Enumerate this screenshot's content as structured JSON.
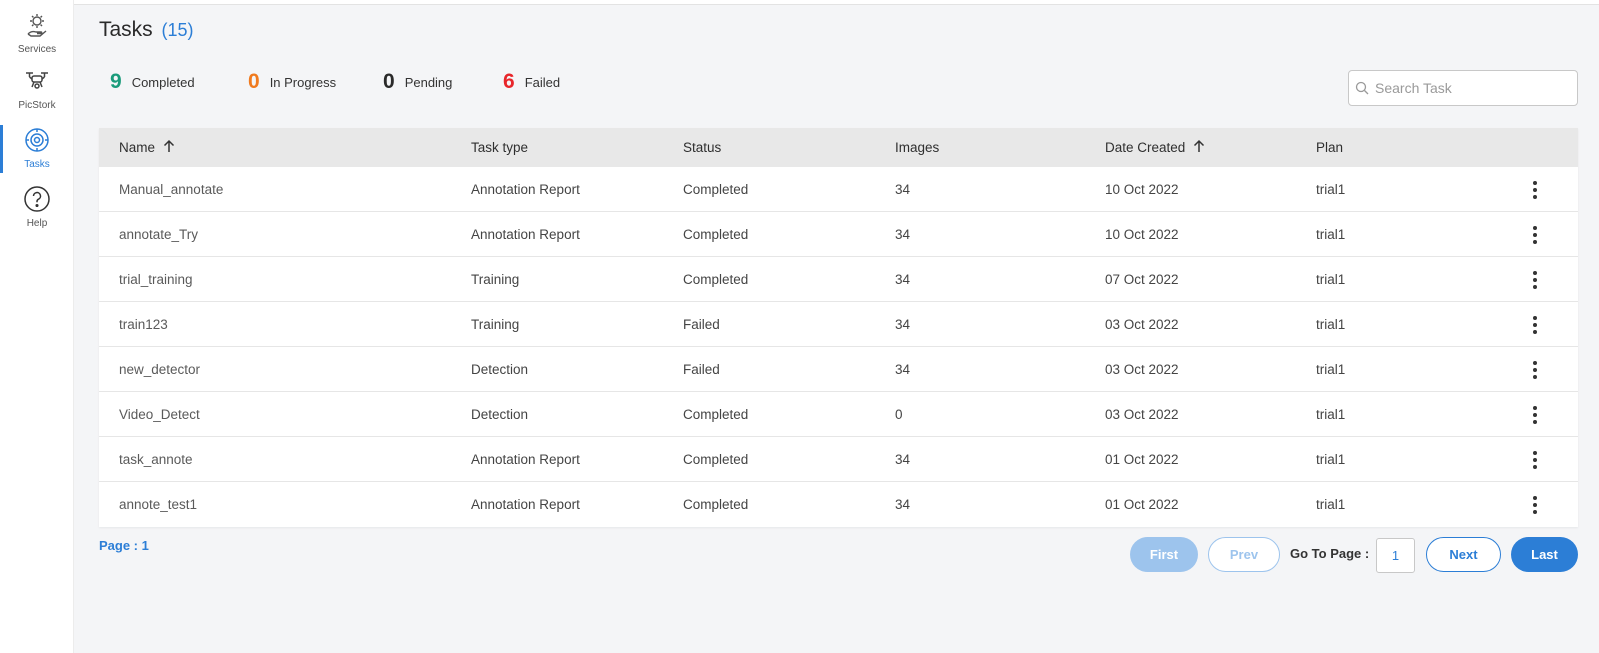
{
  "sidebar": {
    "items": [
      {
        "label": "Services",
        "icon": "gear-hand-icon"
      },
      {
        "label": "PicStork",
        "icon": "drone-icon"
      },
      {
        "label": "Tasks",
        "icon": "gears-icon",
        "active": true
      },
      {
        "label": "Help",
        "icon": "question-circle-icon"
      }
    ]
  },
  "header": {
    "title": "Tasks",
    "count": "(15)"
  },
  "summary": {
    "completed": {
      "value": "9",
      "label": "Completed",
      "color": "#1a9b7b"
    },
    "in_progress": {
      "value": "0",
      "label": "In Progress",
      "color": "#f07a1e"
    },
    "pending": {
      "value": "0",
      "label": "Pending",
      "color": "#2a2a2a"
    },
    "failed": {
      "value": "6",
      "label": "Failed",
      "color": "#e8262b"
    }
  },
  "search": {
    "placeholder": "Search Task",
    "value": ""
  },
  "table": {
    "columns": {
      "name": "Name",
      "task_type": "Task type",
      "status": "Status",
      "images": "Images",
      "date_created": "Date Created",
      "plan": "Plan"
    },
    "rows": [
      {
        "name": "Manual_annotate",
        "task_type": "Annotation Report",
        "status": "Completed",
        "images": "34",
        "date_created": "10 Oct 2022",
        "plan": "trial1"
      },
      {
        "name": "annotate_Try",
        "task_type": "Annotation Report",
        "status": "Completed",
        "images": "34",
        "date_created": "10 Oct 2022",
        "plan": "trial1"
      },
      {
        "name": "trial_training",
        "task_type": "Training",
        "status": "Completed",
        "images": "34",
        "date_created": "07 Oct 2022",
        "plan": "trial1"
      },
      {
        "name": "train123",
        "task_type": "Training",
        "status": "Failed",
        "images": "34",
        "date_created": "03 Oct 2022",
        "plan": "trial1"
      },
      {
        "name": "new_detector",
        "task_type": "Detection",
        "status": "Failed",
        "images": "34",
        "date_created": "03 Oct 2022",
        "plan": "trial1"
      },
      {
        "name": "Video_Detect",
        "task_type": "Detection",
        "status": "Completed",
        "images": "0",
        "date_created": "03 Oct 2022",
        "plan": "trial1"
      },
      {
        "name": "task_annote",
        "task_type": "Annotation Report",
        "status": "Completed",
        "images": "34",
        "date_created": "01 Oct 2022",
        "plan": "trial1"
      },
      {
        "name": "annote_test1",
        "task_type": "Annotation Report",
        "status": "Completed",
        "images": "34",
        "date_created": "01 Oct 2022",
        "plan": "trial1"
      }
    ]
  },
  "pagination": {
    "page_info": "Page : 1",
    "first": "First",
    "prev": "Prev",
    "goto_label": "Go To Page :",
    "goto_value": "1",
    "next": "Next",
    "last": "Last"
  },
  "colors": {
    "accent": "#2c7ed6"
  }
}
